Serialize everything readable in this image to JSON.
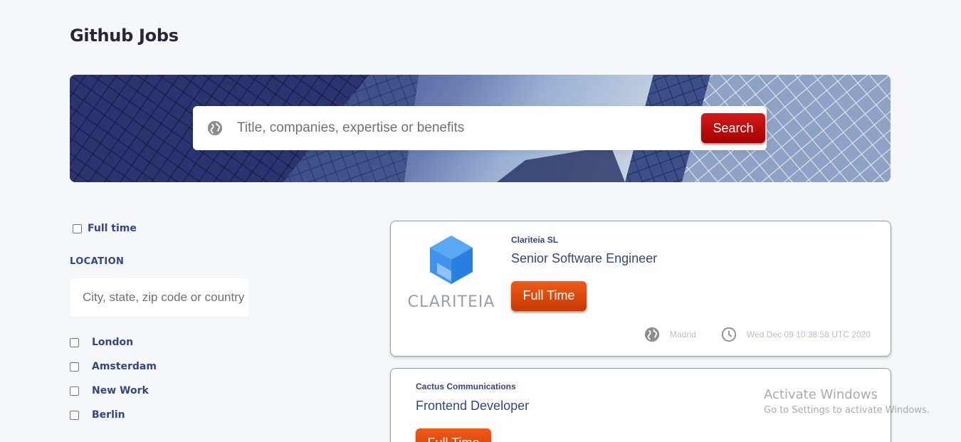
{
  "header": {
    "title": "Github Jobs"
  },
  "search": {
    "placeholder": "Title, companies, expertise or benefits",
    "button_label": "Search",
    "icon": "globe-icon"
  },
  "filters": {
    "full_time_label": "Full time",
    "location_title": "LOCATION",
    "location_placeholder": "City, state, zip code or country",
    "cities": [
      "London",
      "Amsterdam",
      "New Work",
      "Berlin"
    ]
  },
  "jobs": [
    {
      "company": "Clariteia SL",
      "title": "Senior Software Engineer",
      "type": "Full Time",
      "location": "Madrid",
      "posted": "Wed Dec 09 10:38:58 UTC 2020",
      "logo_text": "CLARITEIA"
    },
    {
      "company": "Cactus Communications",
      "title": "Frontend Developer",
      "type": "Full Time"
    }
  ],
  "watermark": {
    "line1": "Activate Windows",
    "line2": "Go to Settings to activate Windows."
  },
  "colors": {
    "primary_text": "#334680",
    "search_button": "#b50000",
    "badge": "#e04a0e",
    "background": "#f6f7fb"
  }
}
